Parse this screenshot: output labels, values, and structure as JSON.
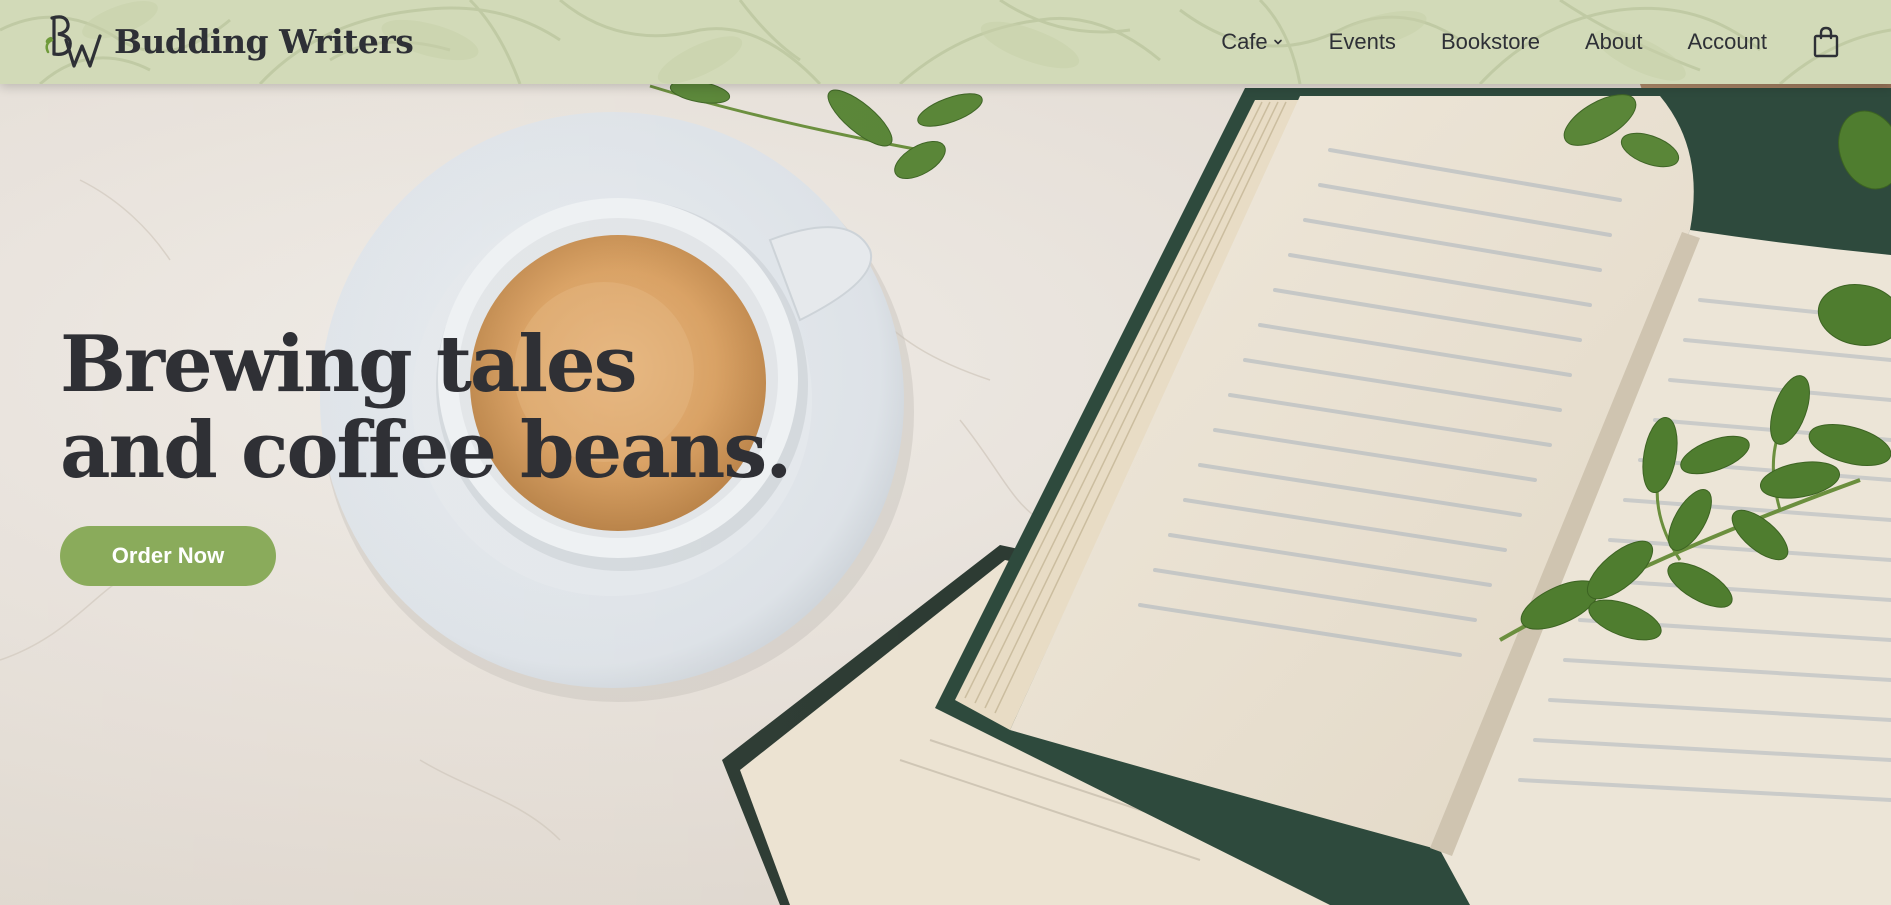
{
  "brand": {
    "name": "Budding Writers",
    "monogram": "BW",
    "header_bg": "#d2dab8",
    "accent": "#8aab5b",
    "text_dark": "#2e3036"
  },
  "nav": {
    "items": [
      {
        "label": "Cafe",
        "has_dropdown": true,
        "icon": "chevron-down-icon"
      },
      {
        "label": "Events"
      },
      {
        "label": "Bookstore"
      },
      {
        "label": "About"
      },
      {
        "label": "Account"
      }
    ],
    "cart_icon": "shopping-bag-icon"
  },
  "hero": {
    "headline_line1": "Brewing tales",
    "headline_line2": "and coffee beans.",
    "cta_label": "Order Now",
    "image": "coffee-cup-and-open-book-photo"
  }
}
